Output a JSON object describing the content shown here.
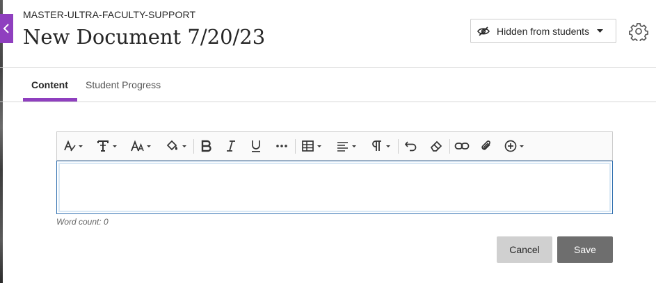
{
  "header": {
    "course_name": "MASTER-ULTRA-FACULTY-SUPPORT",
    "document_title": "New Document 7/20/23",
    "visibility_label": "Hidden from students"
  },
  "tabs": [
    {
      "label": "Content",
      "selected": true
    },
    {
      "label": "Student Progress",
      "selected": false
    }
  ],
  "editor": {
    "toolbar_icons": [
      "text-style-icon",
      "paragraph-format-icon",
      "font-size-icon",
      "fill-color-icon",
      "bold-icon",
      "italic-icon",
      "underline-icon",
      "more-icon",
      "table-icon",
      "align-icon",
      "paragraph-mark-icon",
      "undo-icon",
      "clear-format-icon",
      "link-icon",
      "attach-icon",
      "insert-content-icon"
    ],
    "content": "",
    "word_count": "Word count: 0"
  },
  "actions": {
    "cancel_label": "Cancel",
    "save_label": "Save"
  },
  "colors": {
    "accent": "#8f3fbf",
    "focus_border": "#2f6fb0",
    "save_bg": "#6e6e6e",
    "cancel_bg": "#d0d0d0"
  }
}
